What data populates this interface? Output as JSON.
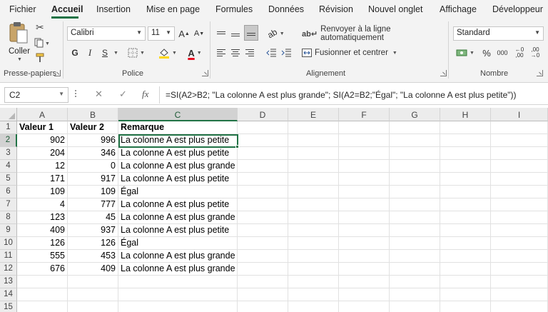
{
  "tabs": [
    "Fichier",
    "Accueil",
    "Insertion",
    "Mise en page",
    "Formules",
    "Données",
    "Révision",
    "Nouvel onglet",
    "Affichage",
    "Développeur"
  ],
  "active_tab": "Accueil",
  "ribbon": {
    "clipboard": {
      "paste_label": "Coller",
      "group_label": "Presse-papiers"
    },
    "font": {
      "font_name": "Calibri",
      "font_size": "11",
      "bold": "G",
      "italic": "I",
      "underline": "S",
      "group_label": "Police"
    },
    "alignment": {
      "wrap_label": "Renvoyer à la ligne automatiquement",
      "merge_label": "Fusionner et centrer",
      "group_label": "Alignement"
    },
    "number": {
      "format": "Standard",
      "percent": "%",
      "thousands": "000",
      "group_label": "Nombre"
    }
  },
  "formula_bar": {
    "name_box": "C2",
    "formula": "=SI(A2>B2; \"La colonne A est plus grande\"; SI(A2=B2;\"Égal\"; \"La colonne A est plus petite\"))"
  },
  "columns": [
    "A",
    "B",
    "C",
    "D",
    "E",
    "F",
    "G",
    "H",
    "I"
  ],
  "rows": [
    [
      "Valeur 1",
      "Valeur 2",
      "Remarque"
    ],
    [
      "902",
      "996",
      "La colonne A est plus petite"
    ],
    [
      "204",
      "346",
      "La colonne A est plus petite"
    ],
    [
      "12",
      "0",
      "La colonne A est plus grande"
    ],
    [
      "171",
      "917",
      "La colonne A est plus petite"
    ],
    [
      "109",
      "109",
      "Égal"
    ],
    [
      "4",
      "777",
      "La colonne A est plus petite"
    ],
    [
      "123",
      "45",
      "La colonne A est plus grande"
    ],
    [
      "409",
      "937",
      "La colonne A est plus petite"
    ],
    [
      "126",
      "126",
      "Égal"
    ],
    [
      "555",
      "453",
      "La colonne A est plus grande"
    ],
    [
      "676",
      "409",
      "La colonne A est plus grande"
    ],
    [
      "",
      "",
      ""
    ],
    [
      "",
      "",
      ""
    ],
    [
      "",
      "",
      ""
    ]
  ],
  "row_numbers": [
    "1",
    "2",
    "3",
    "4",
    "5",
    "6",
    "7",
    "8",
    "9",
    "10",
    "11",
    "12",
    "13",
    "14",
    "15"
  ],
  "selected_cell": "C2",
  "colors": {
    "accent": "#217346",
    "font_color": "#e81123",
    "highlight": "#ffd700"
  }
}
